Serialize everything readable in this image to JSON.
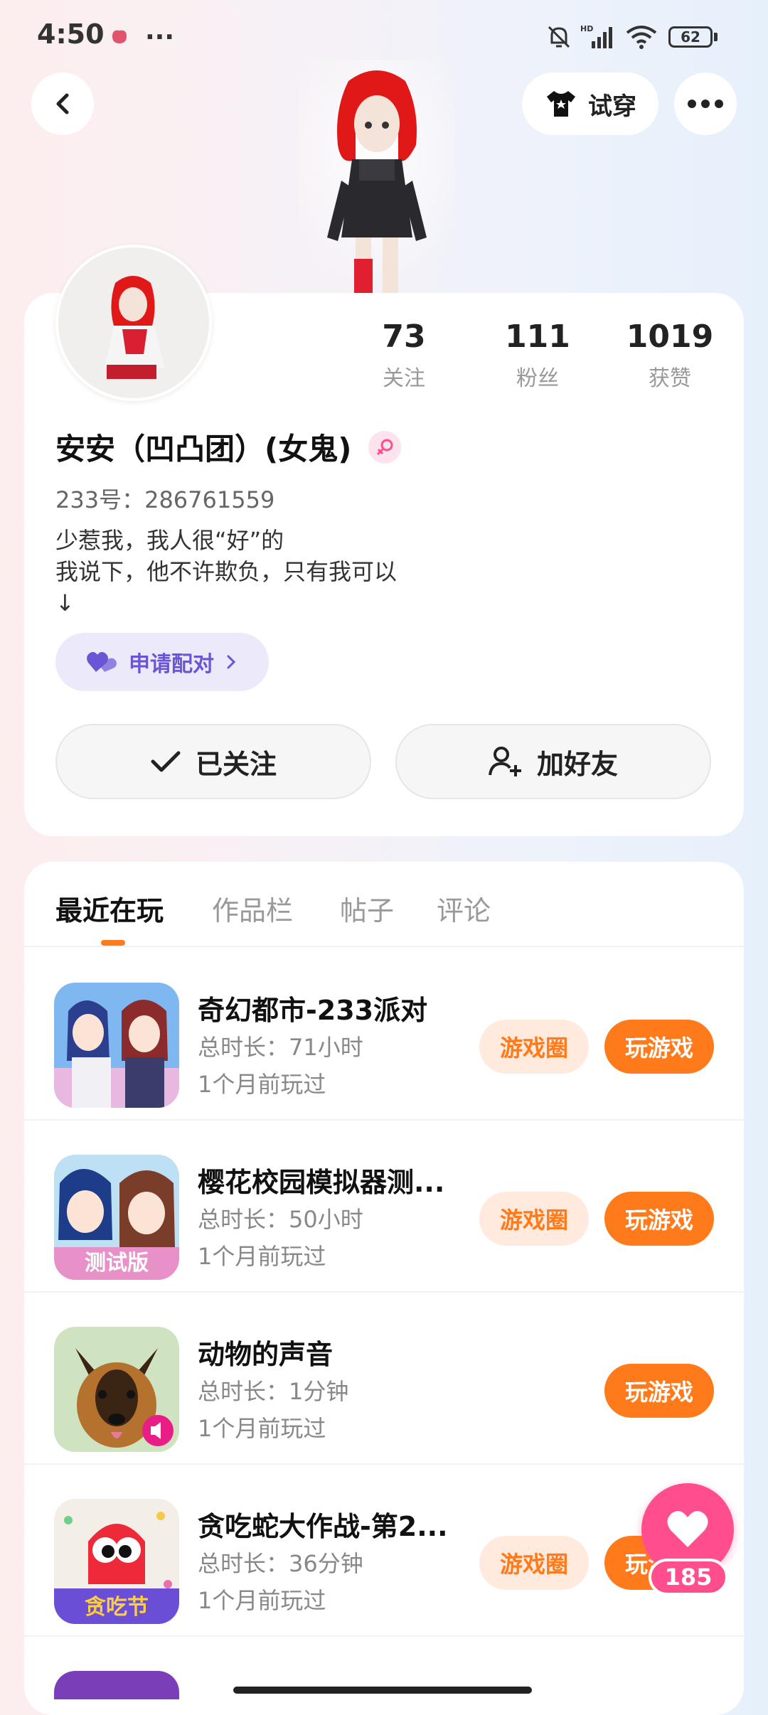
{
  "status_bar": {
    "time": "4:50",
    "battery": "62",
    "network": "HD"
  },
  "header": {
    "tryon_label": "试穿"
  },
  "profile": {
    "stats": [
      {
        "value": "73",
        "label": "关注"
      },
      {
        "value": "111",
        "label": "粉丝"
      },
      {
        "value": "1019",
        "label": "获赞"
      }
    ],
    "name": "安安（凹凸团）(女鬼)",
    "user_id": "233号：286761559",
    "bio_lines": [
      "少惹我，我人很“好”的",
      "我说下，他不许欺负，只有我可以",
      "↓"
    ],
    "pair_label": "申请配对",
    "follow_label": "已关注",
    "add_friend_label": "加好友"
  },
  "tabs": [
    {
      "label": "最近在玩",
      "active": true
    },
    {
      "label": "作品栏",
      "active": false
    },
    {
      "label": "帖子",
      "active": false
    },
    {
      "label": "评论",
      "active": false
    }
  ],
  "games": [
    {
      "title": "奇幻都市-233派对",
      "duration": "总时长：71小时",
      "last_played": "1个月前玩过",
      "has_circle": true
    },
    {
      "title": "樱花校园模拟器测...",
      "duration": "总时长：50小时",
      "last_played": "1个月前玩过",
      "has_circle": true,
      "badge": "测试版"
    },
    {
      "title": "动物的声音",
      "duration": "总时长：1分钟",
      "last_played": "1个月前玩过",
      "has_circle": false
    },
    {
      "title": "贪吃蛇大作战-第2...",
      "duration": "总时长：36分钟",
      "last_played": "1个月前玩过",
      "has_circle": true,
      "badge": "贪吃节"
    }
  ],
  "game_buttons": {
    "circle": "游戏圈",
    "play": "玩游戏"
  },
  "like_count": "185",
  "colors": {
    "accent": "#ff7a1a",
    "pink": "#ff4d8d",
    "purple": "#6a55d6"
  }
}
